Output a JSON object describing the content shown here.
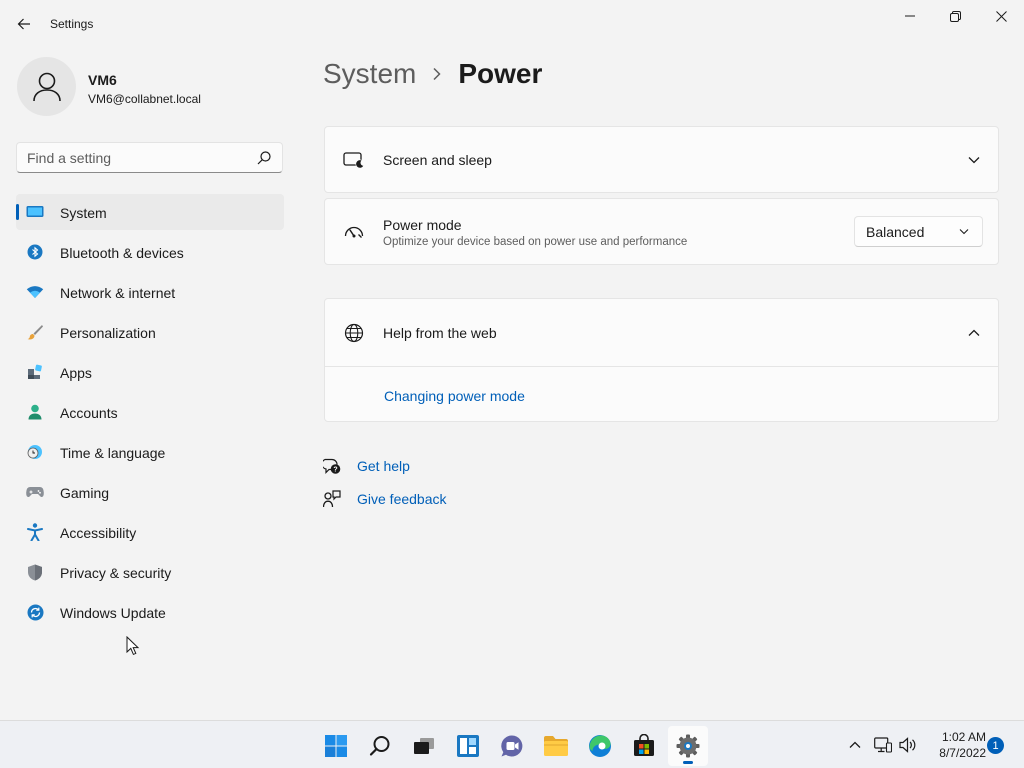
{
  "window": {
    "title": "Settings"
  },
  "profile": {
    "name": "VM6",
    "email": "VM6@collabnet.local"
  },
  "search": {
    "placeholder": "Find a setting"
  },
  "sidebar": {
    "items": [
      {
        "label": "System",
        "icon": "monitor-icon",
        "active": true
      },
      {
        "label": "Bluetooth & devices",
        "icon": "bluetooth-icon"
      },
      {
        "label": "Network & internet",
        "icon": "wifi-icon"
      },
      {
        "label": "Personalization",
        "icon": "brush-icon"
      },
      {
        "label": "Apps",
        "icon": "apps-icon"
      },
      {
        "label": "Accounts",
        "icon": "person-icon"
      },
      {
        "label": "Time & language",
        "icon": "clock-globe-icon"
      },
      {
        "label": "Gaming",
        "icon": "gamepad-icon"
      },
      {
        "label": "Accessibility",
        "icon": "accessibility-icon"
      },
      {
        "label": "Privacy & security",
        "icon": "shield-icon"
      },
      {
        "label": "Windows Update",
        "icon": "update-icon"
      }
    ]
  },
  "breadcrumb": {
    "parent": "System",
    "current": "Power"
  },
  "cards": {
    "screen_sleep": {
      "title": "Screen and sleep"
    },
    "power_mode": {
      "title": "Power mode",
      "subtitle": "Optimize your device based on power use and performance",
      "selected": "Balanced"
    },
    "help": {
      "title": "Help from the web",
      "link": "Changing power mode"
    }
  },
  "links": {
    "get_help": "Get help",
    "give_feedback": "Give feedback"
  },
  "taskbar": {
    "time": "1:02 AM",
    "date": "8/7/2022",
    "notifications": "1"
  },
  "colors": {
    "accent": "#005fb8",
    "background": "#f3f3f3",
    "card": "#fbfbfb"
  }
}
